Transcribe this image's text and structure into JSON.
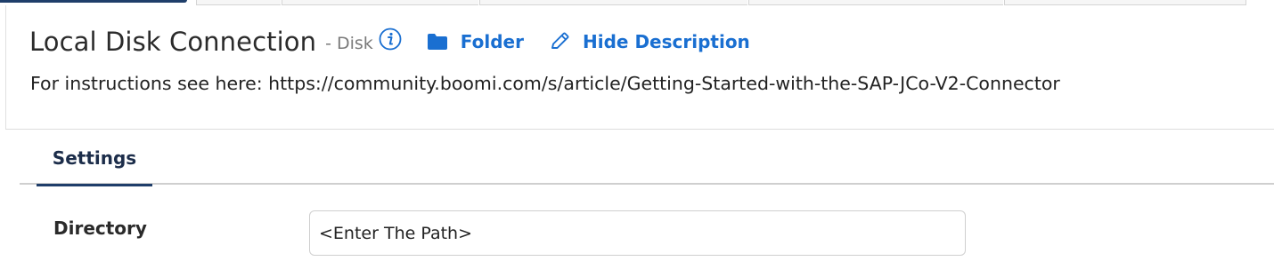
{
  "header": {
    "title": "Local Disk Connection",
    "subtitle": "- Disk",
    "info_icon": "info-icon",
    "folder_label": "Folder",
    "folder_icon": "folder-icon",
    "hide_description_label": "Hide Description",
    "hide_description_icon": "pencil-icon",
    "description": "For instructions see here: https://community.boomi.com/s/article/Getting-Started-with-the-SAP-JCo-V2-Connector"
  },
  "tabs": {
    "items": [
      {
        "label": "Settings",
        "active": true
      }
    ]
  },
  "form": {
    "directory": {
      "label": "Directory",
      "value": "<Enter The Path>",
      "placeholder": ""
    }
  },
  "colors": {
    "accent": "#1a6fd1",
    "tab_active": "#1f3e6a",
    "text": "#222222",
    "muted": "#7a7a7a"
  }
}
